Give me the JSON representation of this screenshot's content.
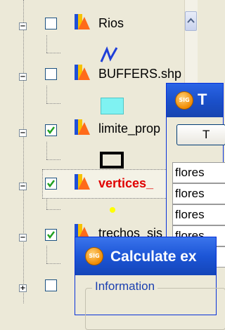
{
  "layers": [
    {
      "label": "Rios",
      "checked": false,
      "expander": "−",
      "icon": "layer-icon",
      "legend": "river-line-symbol-icon"
    },
    {
      "label": "BUFFERS.shp",
      "checked": false,
      "expander": "−",
      "icon": "layer-icon",
      "legend": "cyan-polygon-symbol-icon"
    },
    {
      "label": "limite_prop",
      "checked": true,
      "expander": "−",
      "icon": "layer-icon",
      "legend": "black-polygon-symbol-icon"
    },
    {
      "label": "vertices_",
      "checked": true,
      "expander": "−",
      "icon": "layer-icon",
      "legend": "yellow-point-symbol-icon",
      "highlight": true
    },
    {
      "label": "trechos_sis",
      "checked": true,
      "expander": "−",
      "icon": "layer-icon",
      "legend": "line-symbol-icon"
    },
    {
      "label": "",
      "checked": false,
      "expander": "+",
      "icon": "layer-icon"
    }
  ],
  "table_window": {
    "title": "T",
    "button_label": "T",
    "rows": [
      "flores",
      "flores",
      "flores",
      "flores",
      "fl"
    ]
  },
  "calc_dialog": {
    "title": "Calculate ex",
    "groupbox_label": "Information",
    "app_icon_text": "SIG"
  },
  "colors": {
    "titlebar": "#1a4fc8",
    "highlight_text": "#e00000",
    "check": "#21a121",
    "river": "#1f3fd8",
    "buffer": "#7ff2f2",
    "point": "#ffff00"
  }
}
